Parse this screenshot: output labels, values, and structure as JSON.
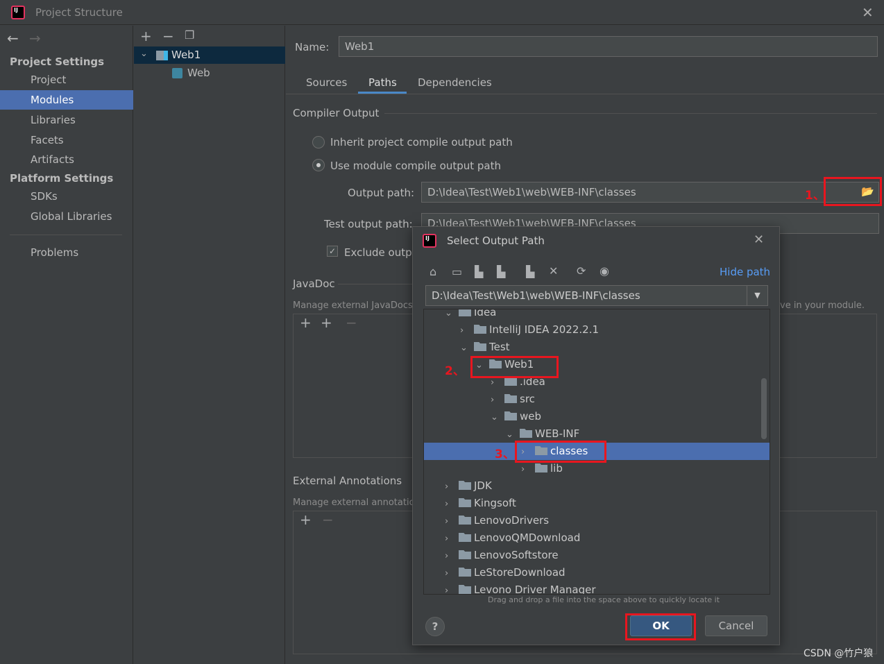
{
  "window": {
    "title": "Project Structure"
  },
  "sidebar": {
    "project_settings": "Project Settings",
    "platform_settings": "Platform Settings",
    "items": [
      {
        "label": "Project"
      },
      {
        "label": "Modules"
      },
      {
        "label": "Libraries"
      },
      {
        "label": "Facets"
      },
      {
        "label": "Artifacts"
      }
    ],
    "platform_items": [
      {
        "label": "SDKs"
      },
      {
        "label": "Global Libraries"
      }
    ],
    "problems": "Problems"
  },
  "module_tree": {
    "root": "Web1",
    "child": "Web"
  },
  "main": {
    "name_label": "Name:",
    "name_value": "Web1",
    "tabs": [
      {
        "label": "Sources"
      },
      {
        "label": "Paths"
      },
      {
        "label": "Dependencies"
      }
    ],
    "compiler_output": "Compiler Output",
    "inherit": "Inherit project compile output path",
    "use_module": "Use module compile output path",
    "output_label": "Output path:",
    "output_value": "D:\\Idea\\Test\\Web1\\web\\WEB-INF\\classes",
    "test_label": "Test output path:",
    "test_value": "D:\\Idea\\Test\\Web1\\web\\WEB-INF\\classes",
    "exclude": "Exclude outpu",
    "javadoc": "JavaDoc",
    "javadoc_hint": "Manage external JavaDocs a",
    "javadoc_hint_right": "ve in your module.",
    "ext_annotations": "External Annotations",
    "ext_hint": "Manage external annotation"
  },
  "annotations": {
    "a1": "1、",
    "a2": "2、",
    "a3": "3、"
  },
  "dialog": {
    "title": "Select Output Path",
    "hide_path": "Hide path",
    "path_value": "D:\\Idea\\Test\\Web1\\web\\WEB-INF\\classes",
    "tree": [
      {
        "label": "Idea",
        "level": 0,
        "open": true
      },
      {
        "label": "IntelliJ IDEA 2022.2.1",
        "level": 1,
        "open": false
      },
      {
        "label": "Test",
        "level": 1,
        "open": true
      },
      {
        "label": "Web1",
        "level": 2,
        "open": true
      },
      {
        "label": ".idea",
        "level": 3,
        "open": false
      },
      {
        "label": "src",
        "level": 3,
        "open": false
      },
      {
        "label": "web",
        "level": 3,
        "open": true
      },
      {
        "label": "WEB-INF",
        "level": 4,
        "open": true
      },
      {
        "label": "classes",
        "level": 5,
        "open": false,
        "selected": true
      },
      {
        "label": "lib",
        "level": 5,
        "open": false
      },
      {
        "label": "JDK",
        "level": 0,
        "open": false
      },
      {
        "label": "Kingsoft",
        "level": 0,
        "open": false
      },
      {
        "label": "LenovoDrivers",
        "level": 0,
        "open": false
      },
      {
        "label": "LenovoQMDownload",
        "level": 0,
        "open": false
      },
      {
        "label": "LenovoSoftstore",
        "level": 0,
        "open": false
      },
      {
        "label": "LeStoreDownload",
        "level": 0,
        "open": false
      },
      {
        "label": "Levono Driver Manager",
        "level": 0,
        "open": false
      }
    ],
    "drag_hint": "Drag and drop a file into the space above to quickly locate it",
    "ok": "OK",
    "cancel": "Cancel",
    "help": "?"
  },
  "watermark": "CSDN @竹户狼",
  "colors": {
    "selection": "#4b6eaf",
    "annotation": "#e8161f",
    "link": "#589df6"
  }
}
